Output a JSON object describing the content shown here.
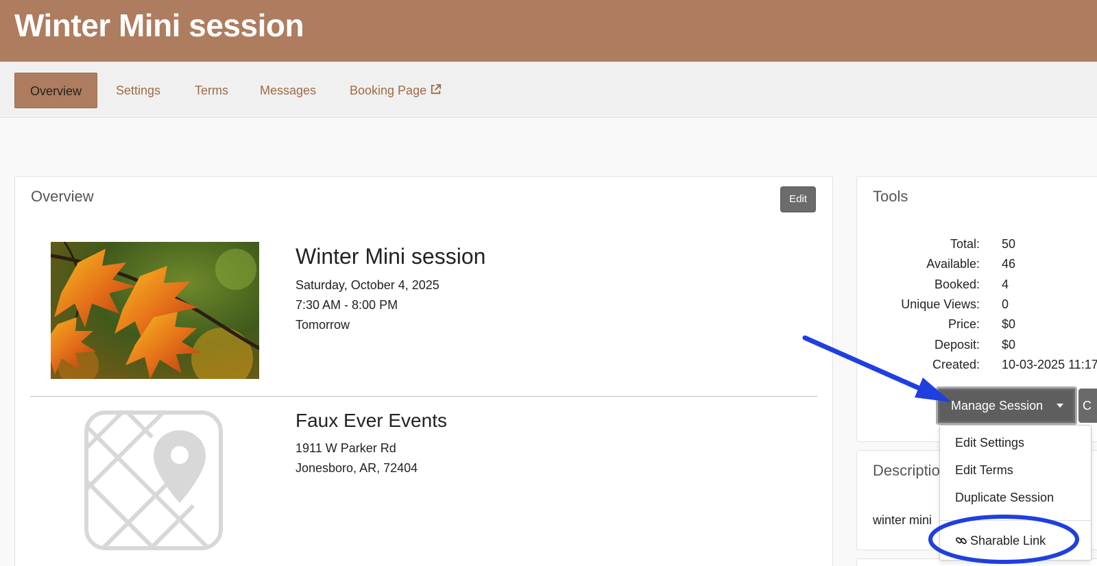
{
  "header": {
    "title": "Winter Mini session"
  },
  "tabs": [
    {
      "label": "Overview"
    },
    {
      "label": "Settings"
    },
    {
      "label": "Terms"
    },
    {
      "label": "Messages"
    },
    {
      "label": "Booking Page"
    }
  ],
  "overview": {
    "title": "Overview",
    "edit_label": "Edit",
    "event": {
      "title": "Winter Mini session",
      "date": "Saturday, October 4, 2025",
      "time": "7:30 AM - 8:00 PM",
      "relative": "Tomorrow"
    },
    "location": {
      "name": "Faux Ever Events",
      "address1": "1911 W Parker Rd",
      "address2": "Jonesboro, AR, 72404"
    }
  },
  "tools": {
    "title": "Tools",
    "stats": [
      {
        "label": "Total:",
        "value": "50"
      },
      {
        "label": "Available:",
        "value": "46"
      },
      {
        "label": "Booked:",
        "value": "4"
      },
      {
        "label": "Unique Views:",
        "value": "0"
      },
      {
        "label": "Price:",
        "value": "$0"
      },
      {
        "label": "Deposit:",
        "value": "$0"
      },
      {
        "label": "Created:",
        "value": "10-03-2025 11:17"
      }
    ],
    "manage_label": "Manage Session",
    "next_button_partial": "C",
    "menu": {
      "items": [
        {
          "label": "Edit Settings"
        },
        {
          "label": "Edit Terms"
        },
        {
          "label": "Duplicate Session"
        }
      ],
      "sharable_link": "Sharable Link"
    }
  },
  "description": {
    "title_partial": "Descriptio",
    "text_partial": "winter mini"
  },
  "colors": {
    "brand": "#ae7c5e",
    "tab_link": "#a06a47",
    "annotation": "#1f3fe0"
  }
}
